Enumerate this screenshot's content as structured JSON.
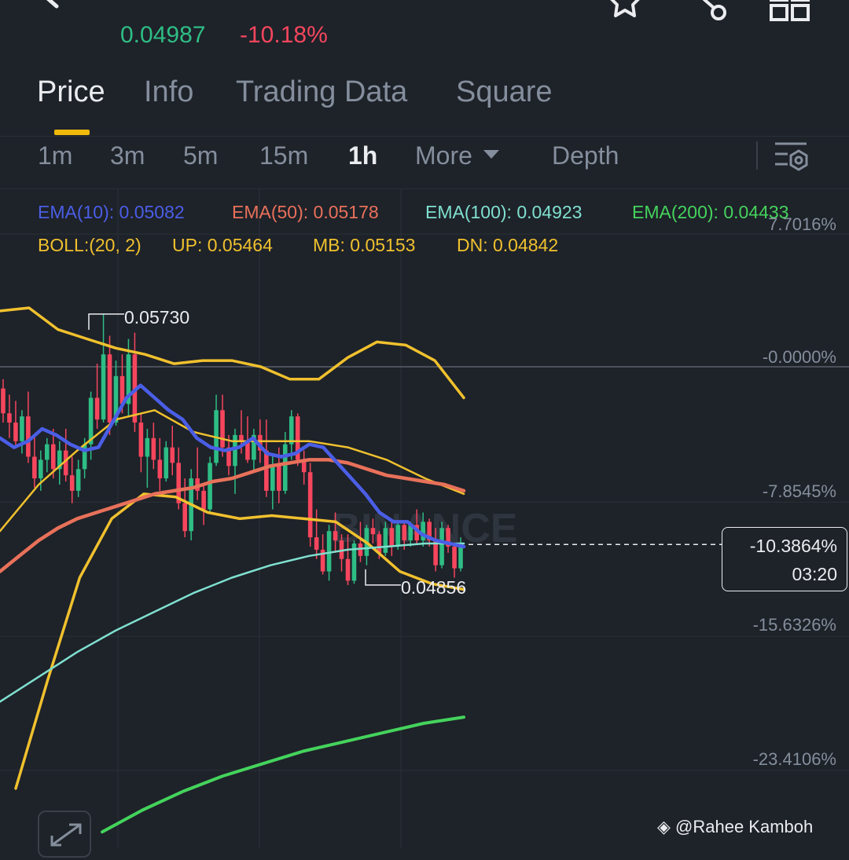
{
  "header": {
    "last_price": "0.04987",
    "change_pct": "-10.18%"
  },
  "tabs": [
    {
      "label": "Price",
      "active": true
    },
    {
      "label": "Info",
      "active": false
    },
    {
      "label": "Trading Data",
      "active": false
    },
    {
      "label": "Square",
      "active": false
    }
  ],
  "intervals": [
    {
      "label": "1m",
      "active": false
    },
    {
      "label": "3m",
      "active": false
    },
    {
      "label": "5m",
      "active": false
    },
    {
      "label": "15m",
      "active": false
    },
    {
      "label": "1h",
      "active": true
    },
    {
      "label": "More",
      "active": false
    },
    {
      "label": "Depth",
      "active": false
    }
  ],
  "indicators": {
    "ema10": "EMA(10): 0.05082",
    "ema50": "EMA(50): 0.05178",
    "ema100": "EMA(100): 0.04923",
    "ema200": "EMA(200): 0.04433",
    "boll": "BOLL:(20, 2)",
    "up": "UP: 0.05464",
    "mb": "MB: 0.05153",
    "dn": "DN: 0.04842"
  },
  "colors": {
    "ema10": "#4a5ee6",
    "ema50": "#e8715a",
    "ema100": "#7fe0cf",
    "ema200": "#44d35c",
    "boll": "#f0c12e",
    "up_candle": "#2ebd85",
    "down_candle": "#f6465d"
  },
  "axis_labels": [
    "7.7016%",
    "-0.0000%",
    "-7.8545%",
    "-15.6326%",
    "-23.4106%"
  ],
  "current": {
    "pct": "-10.3864%",
    "countdown": "03:20"
  },
  "chart_labels": {
    "high": "0.05730",
    "low": "0.04856"
  },
  "watermark": "@Rahee Kamboh",
  "chart_watermark": "BINANCE",
  "chart_data": {
    "type": "candlestick",
    "interval": "1h",
    "y_axis_percent_ticks": [
      7.7016,
      0.0,
      -7.8545,
      -15.6326,
      -23.4106
    ],
    "reference_price": 0.0556,
    "high_marker": 0.0573,
    "low_marker": 0.04856,
    "last_price": 0.04987,
    "candles": [
      [
        0.0549,
        0.0552,
        0.0538,
        0.0541
      ],
      [
        0.0541,
        0.0547,
        0.0533,
        0.0538
      ],
      [
        0.0538,
        0.0545,
        0.053,
        0.0532
      ],
      [
        0.0532,
        0.0542,
        0.0528,
        0.054
      ],
      [
        0.054,
        0.0548,
        0.0525,
        0.0527
      ],
      [
        0.0527,
        0.0534,
        0.0517,
        0.052
      ],
      [
        0.052,
        0.0529,
        0.0516,
        0.0526
      ],
      [
        0.0526,
        0.0533,
        0.0522,
        0.0531
      ],
      [
        0.0531,
        0.0536,
        0.052,
        0.0523
      ],
      [
        0.0523,
        0.0532,
        0.0518,
        0.0529
      ],
      [
        0.0529,
        0.0536,
        0.0519,
        0.0521
      ],
      [
        0.0521,
        0.0527,
        0.0512,
        0.0516
      ],
      [
        0.0516,
        0.0526,
        0.0514,
        0.0523
      ],
      [
        0.0523,
        0.0533,
        0.052,
        0.0531
      ],
      [
        0.0531,
        0.0548,
        0.0526,
        0.0546
      ],
      [
        0.0546,
        0.0557,
        0.0536,
        0.0539
      ],
      [
        0.0539,
        0.0573,
        0.0538,
        0.056
      ],
      [
        0.056,
        0.0566,
        0.0534,
        0.0538
      ],
      [
        0.0538,
        0.0558,
        0.0537,
        0.0553
      ],
      [
        0.0553,
        0.056,
        0.0541,
        0.0544
      ],
      [
        0.0544,
        0.0565,
        0.054,
        0.056
      ],
      [
        0.056,
        0.0567,
        0.0535,
        0.0538
      ],
      [
        0.0538,
        0.0541,
        0.0522,
        0.0527
      ],
      [
        0.0527,
        0.0536,
        0.0517,
        0.0533
      ],
      [
        0.0533,
        0.0538,
        0.0523,
        0.0526
      ],
      [
        0.0526,
        0.0533,
        0.0516,
        0.052
      ],
      [
        0.052,
        0.0532,
        0.0519,
        0.053
      ],
      [
        0.053,
        0.0537,
        0.0521,
        0.0525
      ],
      [
        0.0525,
        0.053,
        0.051,
        0.0512
      ],
      [
        0.0512,
        0.052,
        0.0501,
        0.0503
      ],
      [
        0.0503,
        0.0523,
        0.05,
        0.052
      ],
      [
        0.052,
        0.053,
        0.0513,
        0.0516
      ],
      [
        0.0516,
        0.0518,
        0.0505,
        0.051
      ],
      [
        0.051,
        0.0527,
        0.0509,
        0.0525
      ],
      [
        0.0525,
        0.0547,
        0.0524,
        0.0542
      ],
      [
        0.0542,
        0.0547,
        0.0527,
        0.053
      ],
      [
        0.053,
        0.0534,
        0.0521,
        0.0524
      ],
      [
        0.0524,
        0.0536,
        0.0515,
        0.0534
      ],
      [
        0.0534,
        0.0542,
        0.0528,
        0.0532
      ],
      [
        0.0532,
        0.054,
        0.0525,
        0.0526
      ],
      [
        0.0526,
        0.0536,
        0.0522,
        0.0534
      ],
      [
        0.0534,
        0.0539,
        0.0525,
        0.0529
      ],
      [
        0.0529,
        0.0539,
        0.0514,
        0.0516
      ],
      [
        0.0516,
        0.0527,
        0.051,
        0.0524
      ],
      [
        0.0524,
        0.053,
        0.0512,
        0.0516
      ],
      [
        0.0516,
        0.0535,
        0.0515,
        0.0531
      ],
      [
        0.0531,
        0.0542,
        0.0526,
        0.054
      ],
      [
        0.054,
        0.0541,
        0.0524,
        0.0526
      ],
      [
        0.0526,
        0.0529,
        0.0518,
        0.0522
      ],
      [
        0.0522,
        0.0525,
        0.0498,
        0.0501
      ],
      [
        0.0501,
        0.051,
        0.0494,
        0.0497
      ],
      [
        0.0497,
        0.0502,
        0.0489,
        0.049
      ],
      [
        0.049,
        0.0505,
        0.0487,
        0.0503
      ],
      [
        0.0503,
        0.0509,
        0.0496,
        0.05
      ],
      [
        0.05,
        0.0502,
        0.049,
        0.0494
      ],
      [
        0.0494,
        0.0502,
        0.04856,
        0.0487
      ],
      [
        0.0487,
        0.05,
        0.0486,
        0.0499
      ],
      [
        0.0499,
        0.0506,
        0.0493,
        0.0495
      ],
      [
        0.0495,
        0.0505,
        0.0492,
        0.0504
      ],
      [
        0.0504,
        0.0507,
        0.0499,
        0.0502
      ],
      [
        0.0502,
        0.0503,
        0.0494,
        0.0496
      ],
      [
        0.0496,
        0.0506,
        0.0495,
        0.0504
      ],
      [
        0.0504,
        0.0506,
        0.0495,
        0.0498
      ],
      [
        0.0498,
        0.0506,
        0.0497,
        0.0505
      ],
      [
        0.0505,
        0.0506,
        0.0497,
        0.05
      ],
      [
        0.05,
        0.0506,
        0.0498,
        0.0505
      ],
      [
        0.0505,
        0.051,
        0.0499,
        0.05
      ],
      [
        0.05,
        0.0509,
        0.0498,
        0.0506
      ],
      [
        0.0506,
        0.0507,
        0.0498,
        0.05
      ],
      [
        0.05,
        0.0504,
        0.049,
        0.0492
      ],
      [
        0.0492,
        0.0506,
        0.0491,
        0.0504
      ],
      [
        0.0504,
        0.0505,
        0.0496,
        0.0498
      ],
      [
        0.0498,
        0.0499,
        0.0488,
        0.0491
      ],
      [
        0.0491,
        0.0501,
        0.049,
        0.04987
      ]
    ],
    "series": [
      {
        "name": "EMA(10)",
        "values": [
          0.0533,
          0.053,
          0.0532,
          0.0536,
          0.0534,
          0.0531,
          0.0529,
          0.053,
          0.0538,
          0.0546,
          0.055,
          0.0546,
          0.0542,
          0.0539,
          0.0533,
          0.053,
          0.0529,
          0.053,
          0.0533,
          0.0528,
          0.0527,
          0.0528,
          0.0531,
          0.053,
          0.0525,
          0.052,
          0.0515,
          0.0509,
          0.0506,
          0.0506,
          0.0502,
          0.05,
          0.0499,
          0.0498
        ]
      },
      {
        "name": "EMA(50)",
        "values": [
          0.049,
          0.0495,
          0.05,
          0.0504,
          0.0507,
          0.0509,
          0.0511,
          0.0513,
          0.0515,
          0.0516,
          0.0517,
          0.0519,
          0.052,
          0.0522,
          0.0524,
          0.0525,
          0.0526,
          0.0526,
          0.0525,
          0.0523,
          0.0521,
          0.052,
          0.0519,
          0.0518,
          0.0516
        ]
      },
      {
        "name": "EMA(100)",
        "values": [
          0.0448,
          0.0456,
          0.0464,
          0.0471,
          0.0477,
          0.0483,
          0.0488,
          0.0492,
          0.0495,
          0.0497,
          0.0498,
          0.0499,
          0.0499
        ]
      },
      {
        "name": "EMA(200)",
        "values": [
          0.0406,
          0.0413,
          0.0419,
          0.0424,
          0.0428,
          0.0432,
          0.0435,
          0.0438,
          0.0441,
          0.0443
        ]
      },
      {
        "name": "BOLL UP",
        "values": [
          0.0574,
          0.0575,
          0.0568,
          0.0565,
          0.0562,
          0.056,
          0.0557,
          0.0558,
          0.0558,
          0.0556,
          0.0552,
          0.0552,
          0.0559,
          0.0564,
          0.0563,
          0.0558,
          0.0546
        ]
      },
      {
        "name": "BOLL MB",
        "values": [
          0.0503,
          0.0518,
          0.0529,
          0.0539,
          0.0542,
          0.0535,
          0.0532,
          0.0532,
          0.0532,
          0.053,
          0.0526,
          0.052,
          0.0515
        ]
      },
      {
        "name": "BOLL DN",
        "values": [
          0.042,
          0.0455,
          0.0488,
          0.0507,
          0.0515,
          0.0514,
          0.0509,
          0.0507,
          0.0508,
          0.0507,
          0.0506,
          0.0499,
          0.049,
          0.0486,
          0.04842
        ]
      }
    ]
  }
}
